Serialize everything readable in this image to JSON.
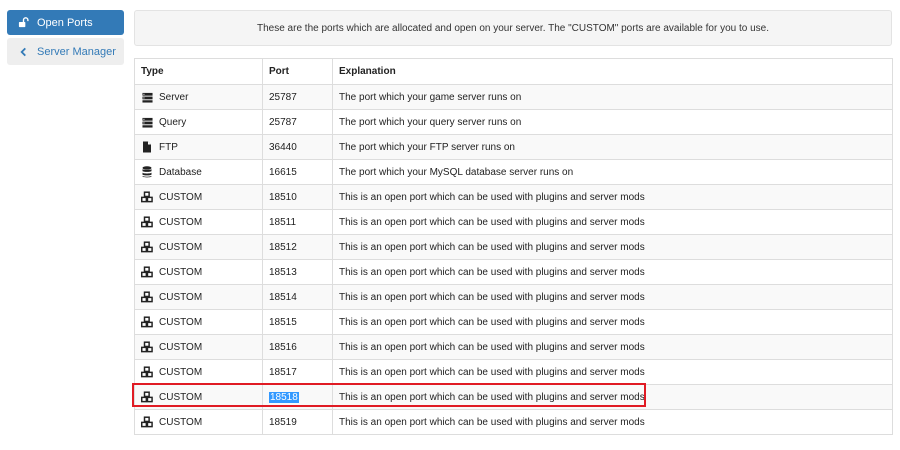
{
  "sidebar": {
    "items": [
      {
        "label": "Open Ports",
        "icon": "unlock-icon",
        "active": true
      },
      {
        "label": "Server Manager",
        "icon": "chevron-left-icon",
        "active": false
      }
    ]
  },
  "notice": {
    "text": "These are the ports which are allocated and open on your server. The \"CUSTOM\" ports are available for you to use."
  },
  "table": {
    "headers": [
      "Type",
      "Port",
      "Explanation"
    ],
    "rows": [
      {
        "type": "Server",
        "icon": "server-icon",
        "port": "25787",
        "explanation": "The port which your game server runs on"
      },
      {
        "type": "Query",
        "icon": "server-icon",
        "port": "25787",
        "explanation": "The port which your query server runs on"
      },
      {
        "type": "FTP",
        "icon": "file-icon",
        "port": "36440",
        "explanation": "The port which your FTP server runs on"
      },
      {
        "type": "Database",
        "icon": "database-icon",
        "port": "16615",
        "explanation": "The port which your MySQL database server runs on"
      },
      {
        "type": "CUSTOM",
        "icon": "cubes-icon",
        "port": "18510",
        "explanation": "This is an open port which can be used with plugins and server mods"
      },
      {
        "type": "CUSTOM",
        "icon": "cubes-icon",
        "port": "18511",
        "explanation": "This is an open port which can be used with plugins and server mods"
      },
      {
        "type": "CUSTOM",
        "icon": "cubes-icon",
        "port": "18512",
        "explanation": "This is an open port which can be used with plugins and server mods"
      },
      {
        "type": "CUSTOM",
        "icon": "cubes-icon",
        "port": "18513",
        "explanation": "This is an open port which can be used with plugins and server mods"
      },
      {
        "type": "CUSTOM",
        "icon": "cubes-icon",
        "port": "18514",
        "explanation": "This is an open port which can be used with plugins and server mods"
      },
      {
        "type": "CUSTOM",
        "icon": "cubes-icon",
        "port": "18515",
        "explanation": "This is an open port which can be used with plugins and server mods"
      },
      {
        "type": "CUSTOM",
        "icon": "cubes-icon",
        "port": "18516",
        "explanation": "This is an open port which can be used with plugins and server mods"
      },
      {
        "type": "CUSTOM",
        "icon": "cubes-icon",
        "port": "18517",
        "explanation": "This is an open port which can be used with plugins and server mods"
      },
      {
        "type": "CUSTOM",
        "icon": "cubes-icon",
        "port": "18518",
        "explanation": "This is an open port which can be used with plugins and server mods",
        "selected": true
      },
      {
        "type": "CUSTOM",
        "icon": "cubes-icon",
        "port": "18519",
        "explanation": "This is an open port which can be used with plugins and server mods"
      }
    ]
  },
  "colors": {
    "accent": "#337ab7",
    "highlight_border": "#e01b24",
    "selection": "#3399ff"
  }
}
